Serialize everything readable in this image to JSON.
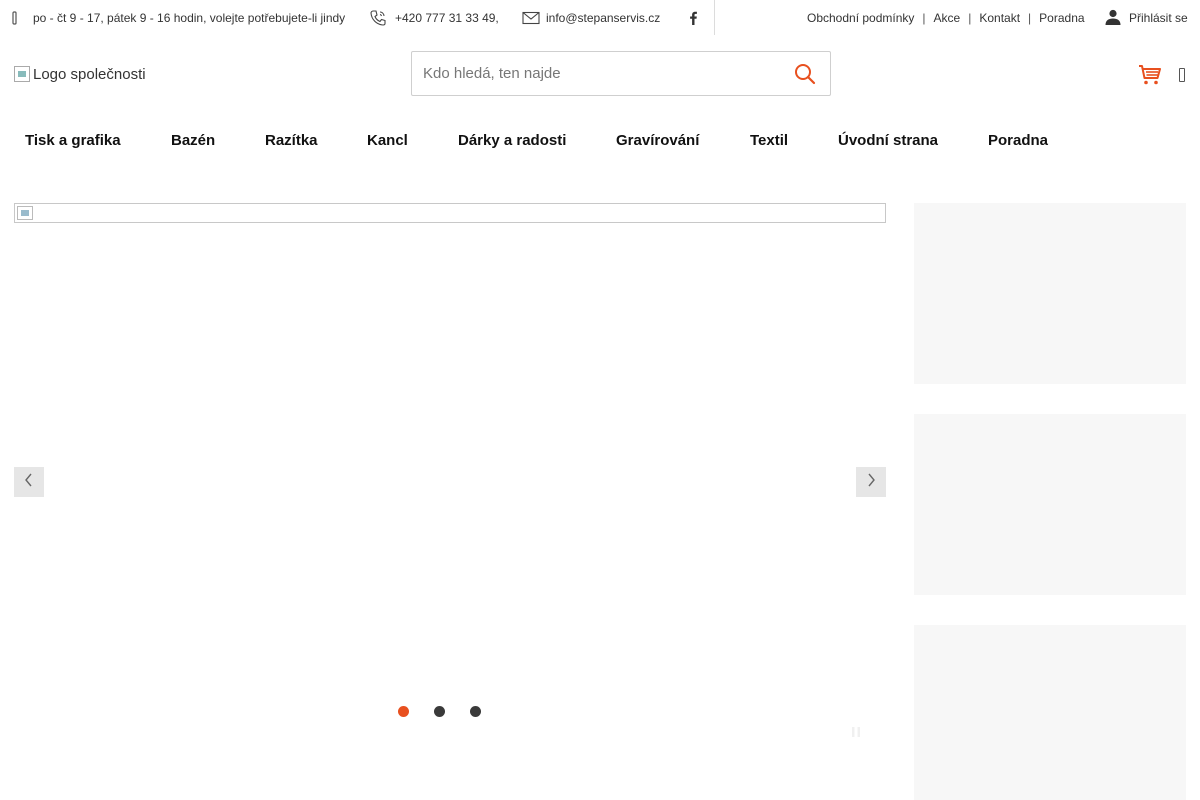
{
  "topbar": {
    "hours": "po - čt 9 - 17, pátek 9 - 16 hodin, volejte potřebujete-li jindy",
    "phone": "+420 777 31 33 49,",
    "email": "info@stepanservis.cz",
    "links": [
      "Obchodní podmínky",
      "Akce",
      "Kontakt",
      "Poradna"
    ],
    "login": "Přihlásit se"
  },
  "header": {
    "logo_alt": "Logo společnosti",
    "search_placeholder": "Kdo hledá, ten najde"
  },
  "nav": [
    "Tisk a grafika",
    "Bazén",
    "Razítka",
    "Kancl",
    "Dárky a radosti",
    "Gravírování",
    "Textil",
    "Úvodní strana",
    "Poradna"
  ],
  "slider": {
    "slides": 3,
    "active_slide": 1
  },
  "colors": {
    "accent": "#e8501f",
    "dot": "#3a3a3a",
    "banner": "#f7f7f7"
  }
}
